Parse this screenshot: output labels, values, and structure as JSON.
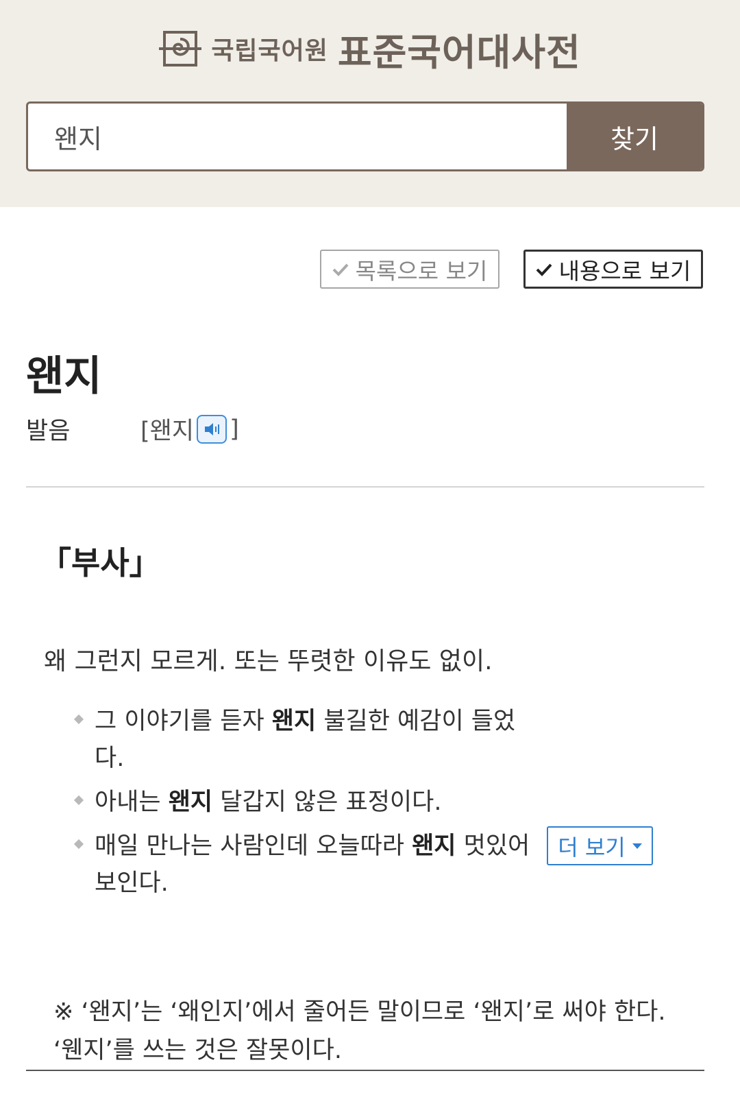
{
  "header": {
    "logo_org": "국립국어원",
    "logo_dict": "표준국어대사전",
    "search_value": "왠지",
    "search_button": "찾기"
  },
  "view_options": {
    "list_label": "목록으로 보기",
    "content_label": "내용으로 보기",
    "selected": "content"
  },
  "entry": {
    "headword": "왠지",
    "pronunciation_label": "발음",
    "pronunciation_open": "[왠지",
    "pronunciation_close": "]",
    "part_of_speech": "「부사」",
    "definition": "왜 그런지 모르게. 또는 뚜렷한 이유도 없이.",
    "examples": [
      {
        "before": "그 이야기를 듣자 ",
        "bold": "왠지",
        "after": " 불길한 예감이 들었다."
      },
      {
        "before": "아내는 ",
        "bold": "왠지",
        "after": " 달갑지 않은 표정이다."
      },
      {
        "before": "매일 만나는 사람인데 오늘따라 ",
        "bold": "왠지",
        "after": " 멋있어 보인다."
      }
    ],
    "more_label": "더 보기",
    "note": "※ ‘왠지’는 ‘왜인지’에서 줄어든 말이므로 ‘왠지’로 써야 한다. ‘웬지’를 쓰는 것은 잘못이다."
  },
  "colors": {
    "header_bg": "#f1eee8",
    "brand_brown": "#7a685c",
    "link_blue": "#2f7fd0"
  }
}
